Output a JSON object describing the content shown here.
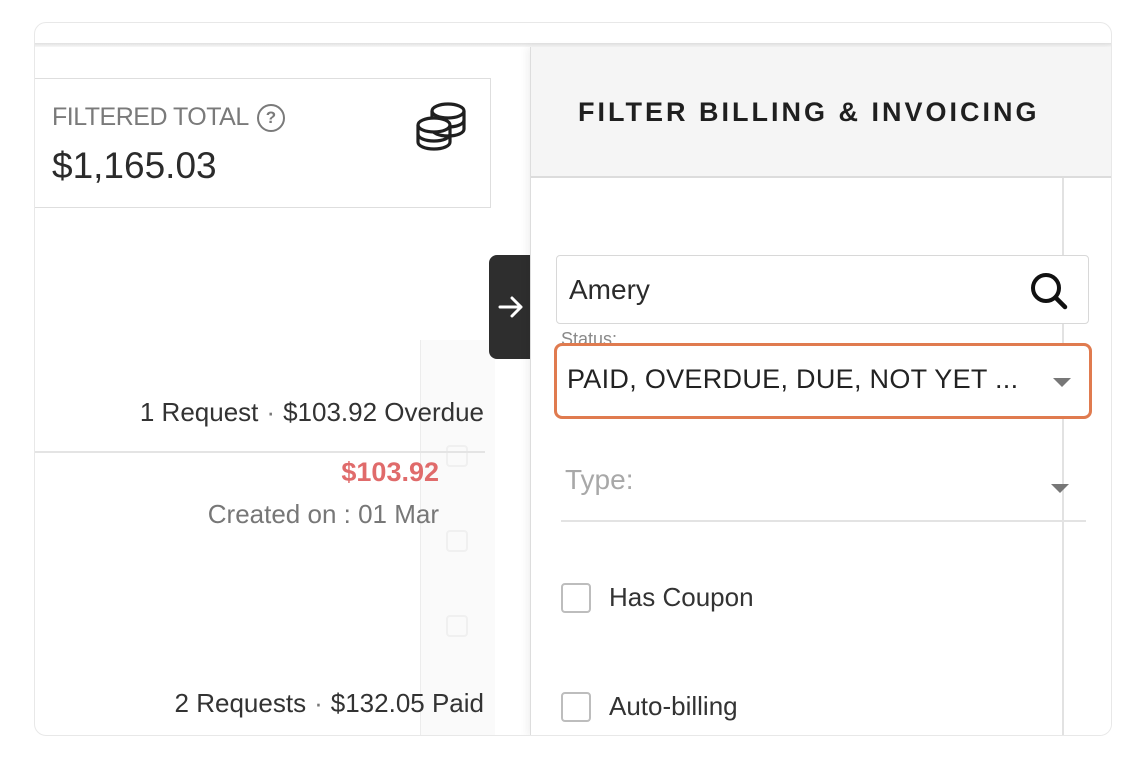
{
  "summary": {
    "total_label": "FILTERED TOTAL",
    "help_icon": "?",
    "total_value": "$1,165.03",
    "coins_icon": "coins-icon"
  },
  "rows": [
    {
      "requests": "1 Request",
      "dot": "·",
      "status": "$103.92 Overdue"
    },
    {
      "requests": "2 Requests",
      "dot": "·",
      "status": "$132.05 Paid"
    }
  ],
  "item": {
    "amount": "$103.92",
    "created": "Created on : 01 Mar"
  },
  "filter_panel": {
    "title": "FILTER BILLING & INVOICING",
    "search_value": "Amery",
    "status_label": "Status:",
    "status_value": "PAID, OVERDUE, DUE, NOT YET ...",
    "type_placeholder": "Type:",
    "has_coupon_label": "Has Coupon",
    "auto_billing_label": "Auto-billing",
    "accent_color": "#e07b4f"
  }
}
